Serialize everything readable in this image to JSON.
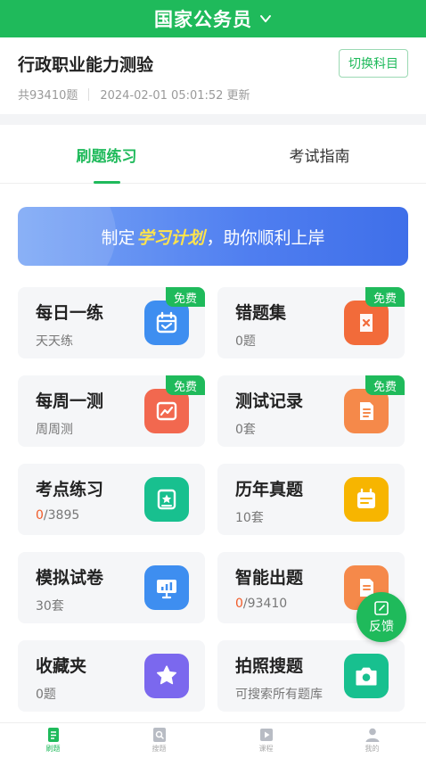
{
  "header": {
    "title": "国家公务员"
  },
  "subject": {
    "name": "行政职业能力测验",
    "count": "共93410题",
    "updated": "2024-02-01 05:01:52 更新",
    "switch_label": "切换科目"
  },
  "tabs": [
    {
      "label": "刷题练习",
      "active": true
    },
    {
      "label": "考试指南",
      "active": false
    }
  ],
  "banner": {
    "prefix": "制定",
    "highlight": "学习计划",
    "suffix": "，助你顺利上岸"
  },
  "badge_label": "免费",
  "cards": [
    {
      "title": "每日一练",
      "sub": "天天练",
      "free": true,
      "icon": "calendar-check-icon",
      "color": "#3e8ef0"
    },
    {
      "title": "错题集",
      "sub": "0题",
      "free": true,
      "icon": "wrong-doc-icon",
      "color": "#f26b3a"
    },
    {
      "title": "每周一测",
      "sub": "周周测",
      "free": true,
      "icon": "trend-chart-icon",
      "color": "#f2684f"
    },
    {
      "title": "测试记录",
      "sub": "0套",
      "free": true,
      "icon": "record-doc-icon",
      "color": "#f5894a"
    },
    {
      "title": "考点练习",
      "sub_red": "0",
      "sub_rest": "/3895",
      "free": false,
      "icon": "star-badge-icon",
      "color": "#18c08f"
    },
    {
      "title": "历年真题",
      "sub": "10套",
      "free": false,
      "icon": "exam-calendar-icon",
      "color": "#f7b500"
    },
    {
      "title": "模拟试卷",
      "sub": "30套",
      "free": false,
      "icon": "presentation-icon",
      "color": "#3e8ef0"
    },
    {
      "title": "智能出题",
      "sub_red": "0",
      "sub_rest": "/93410",
      "free": false,
      "icon": "smart-doc-icon",
      "color": "#f5894a"
    },
    {
      "title": "收藏夹",
      "sub": "0题",
      "free": false,
      "icon": "star-icon",
      "color": "#7b68ee"
    },
    {
      "title": "拍照搜题",
      "sub": "可搜索所有题库",
      "free": false,
      "icon": "camera-icon",
      "color": "#18c08f"
    }
  ],
  "fab": {
    "label": "反馈"
  },
  "nav": [
    {
      "label": "刷题",
      "icon": "practice-icon",
      "active": true
    },
    {
      "label": "搜题",
      "icon": "search-icon",
      "active": false
    },
    {
      "label": "课程",
      "icon": "video-icon",
      "active": false
    },
    {
      "label": "我的",
      "icon": "user-icon",
      "active": false
    }
  ]
}
